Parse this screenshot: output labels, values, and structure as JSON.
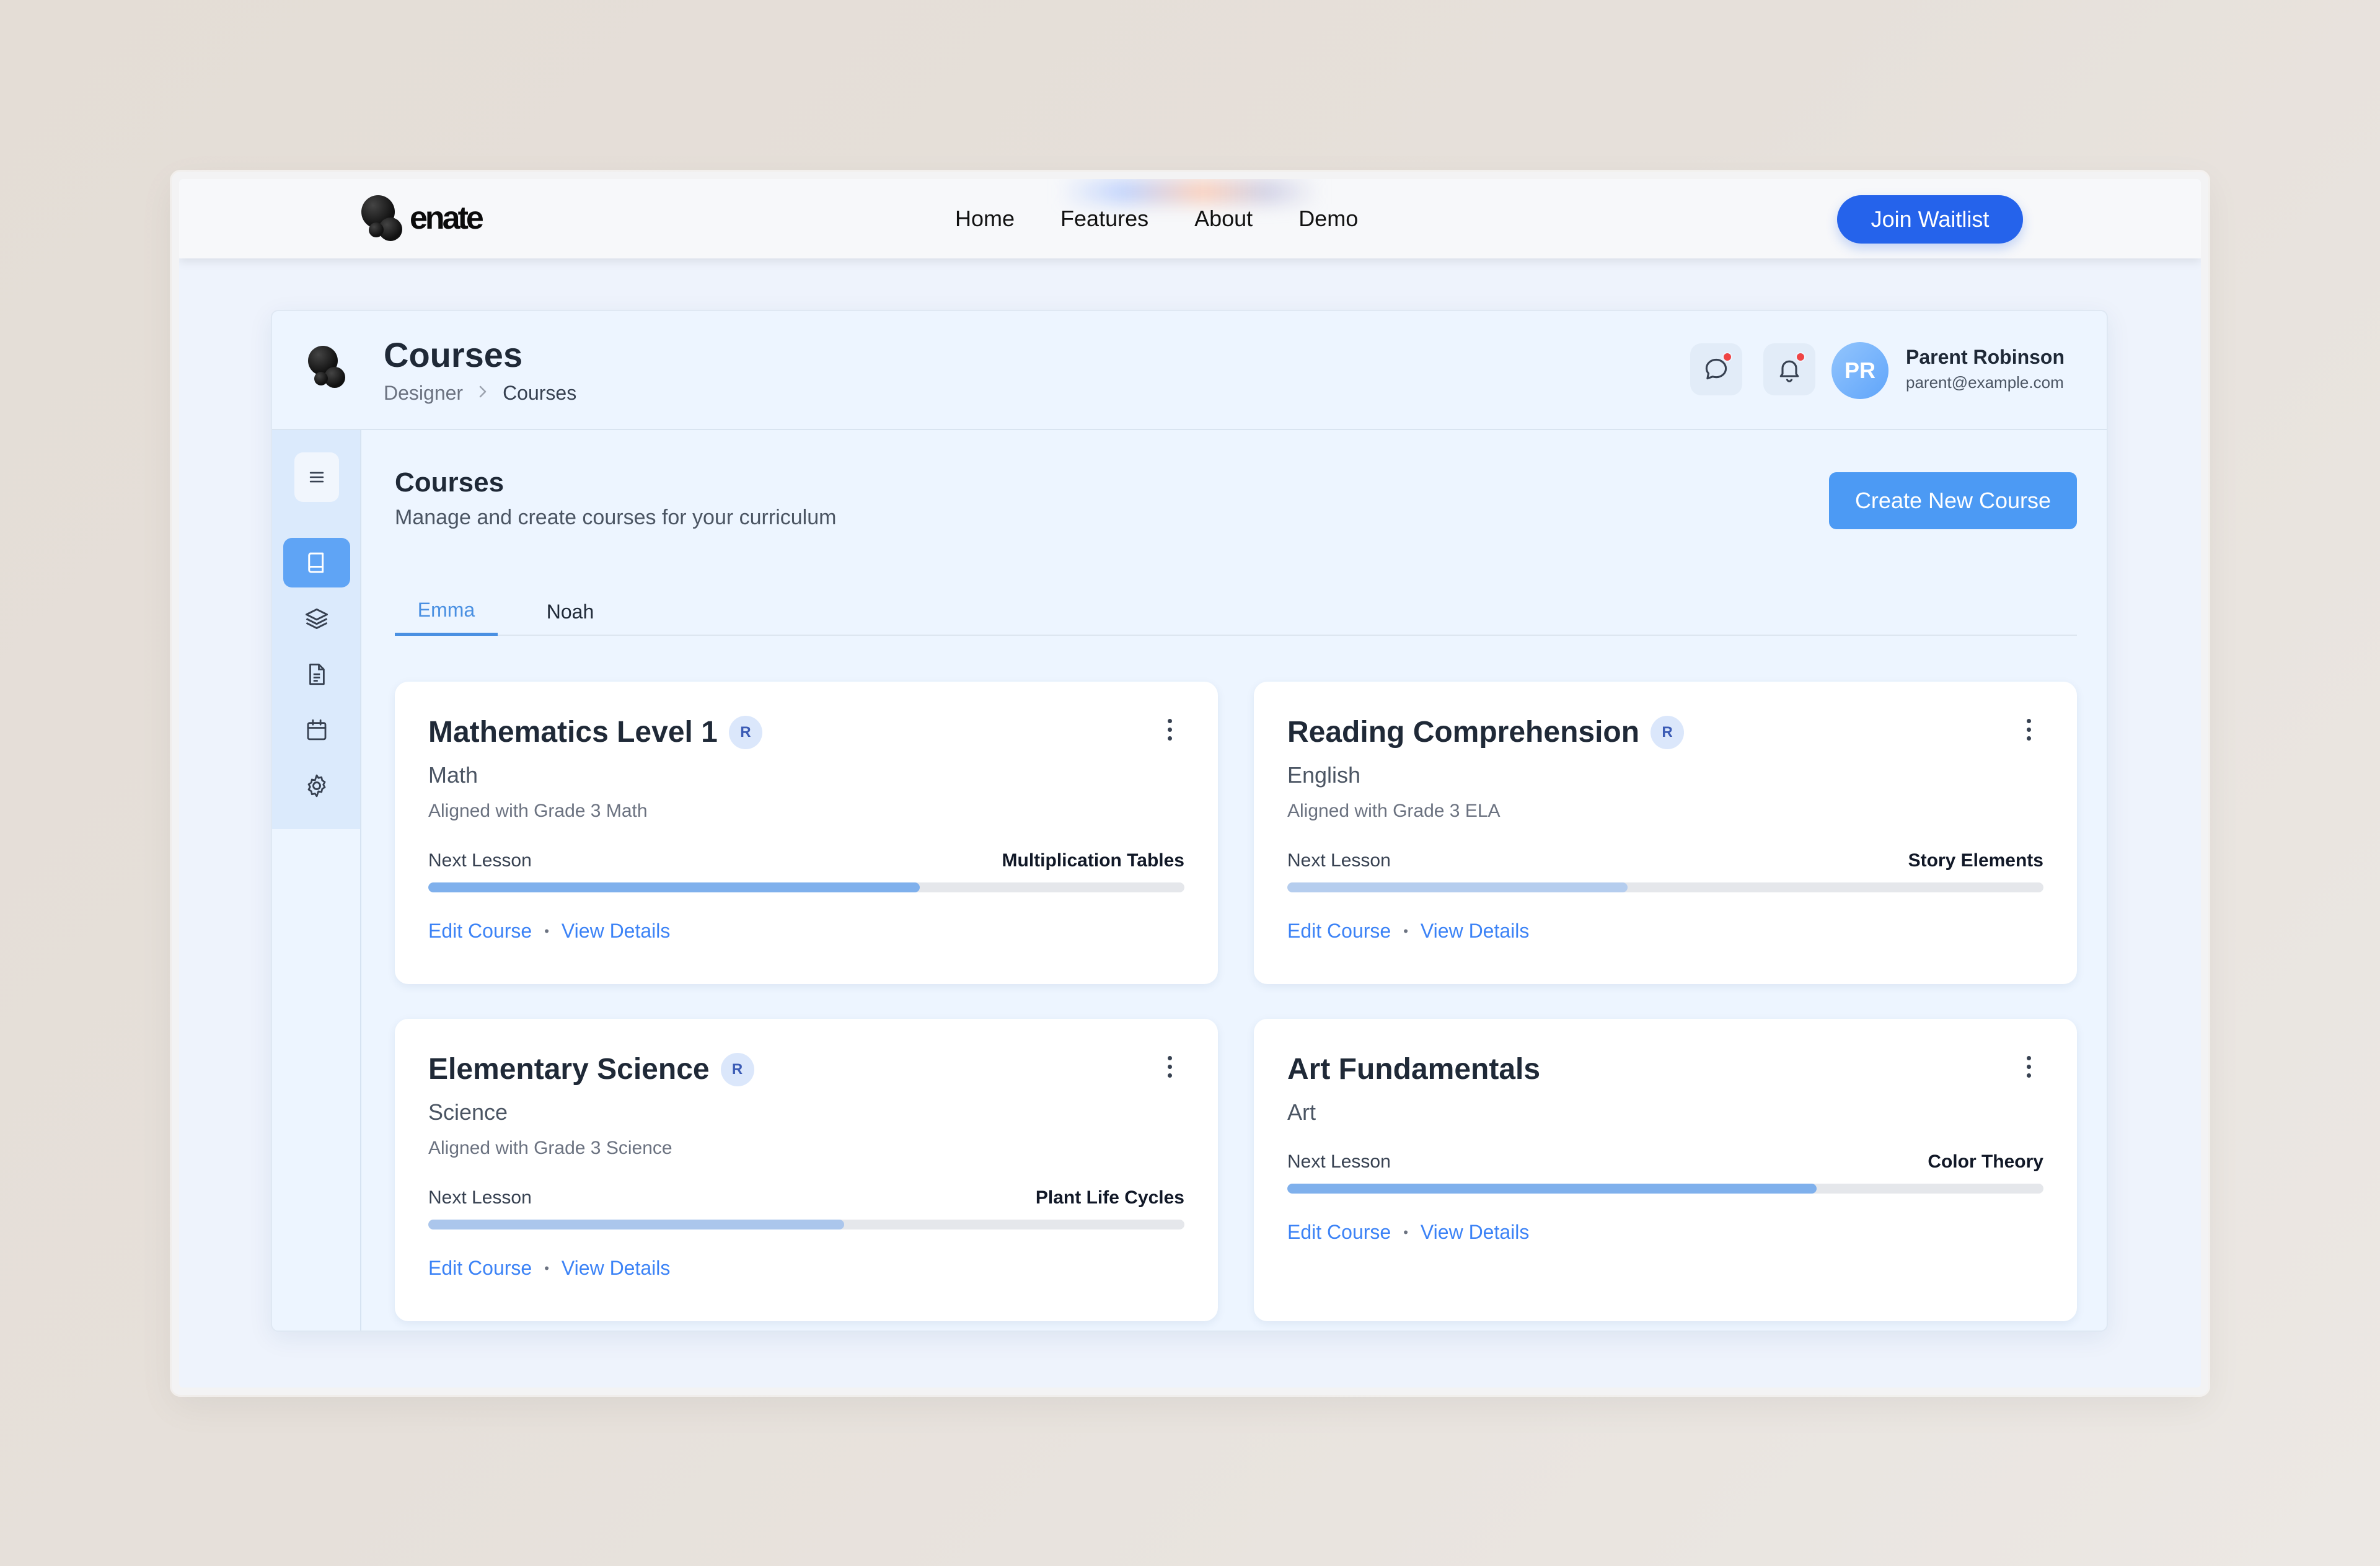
{
  "site": {
    "logo_text": "enate",
    "nav": [
      "Home",
      "Features",
      "About",
      "Demo"
    ],
    "cta": "Join Waitlist"
  },
  "app": {
    "title": "Courses",
    "breadcrumb": {
      "parent": "Designer",
      "current": "Courses"
    },
    "user": {
      "initials": "PR",
      "name": "Parent Robinson",
      "email": "parent@example.com"
    },
    "header_icons": [
      "chat-icon",
      "bell-icon"
    ],
    "sidebar": {
      "menu_icon": "hamburger-icon",
      "items": [
        {
          "icon": "book-icon",
          "active": true
        },
        {
          "icon": "layers-icon",
          "active": false
        },
        {
          "icon": "document-icon",
          "active": false
        },
        {
          "icon": "calendar-icon",
          "active": false
        },
        {
          "icon": "gear-icon",
          "active": false
        }
      ]
    }
  },
  "main": {
    "title": "Courses",
    "subtitle": "Manage and create courses for your curriculum",
    "create_button": "Create New Course",
    "tabs": [
      "Emma",
      "Noah"
    ],
    "active_tab": "Emma"
  },
  "courses": [
    {
      "title": "Mathematics Level 1",
      "badge": "R",
      "subject": "Math",
      "aligned": "Aligned with Grade 3 Math",
      "next_label": "Next Lesson",
      "next_lesson": "Multiplication Tables",
      "progress": 0.65,
      "progress_color": "#7fb0ec",
      "edit": "Edit Course",
      "view": "View Details"
    },
    {
      "title": "Reading Comprehension",
      "badge": "R",
      "subject": "English",
      "aligned": "Aligned with Grade 3 ELA",
      "next_label": "Next Lesson",
      "next_lesson": "Story Elements",
      "progress": 0.45,
      "progress_color": "#b5cdee",
      "edit": "Edit Course",
      "view": "View Details"
    },
    {
      "title": "Elementary Science",
      "badge": "R",
      "subject": "Science",
      "aligned": "Aligned with Grade 3 Science",
      "next_label": "Next Lesson",
      "next_lesson": "Plant Life Cycles",
      "progress": 0.55,
      "progress_color": "#abc6ec",
      "edit": "Edit Course",
      "view": "View Details"
    },
    {
      "title": "Art Fundamentals",
      "badge": "",
      "subject": "Art",
      "aligned": "",
      "next_label": "Next Lesson",
      "next_lesson": "Color Theory",
      "progress": 0.7,
      "progress_color": "#7fb0ec",
      "edit": "Edit Course",
      "view": "View Details"
    }
  ],
  "colors": {
    "primary": "#2563eb",
    "accent": "#4c9af4",
    "tab_active": "#4a90e2",
    "link": "#3b82f6",
    "notification_dot": "#ef4444"
  }
}
